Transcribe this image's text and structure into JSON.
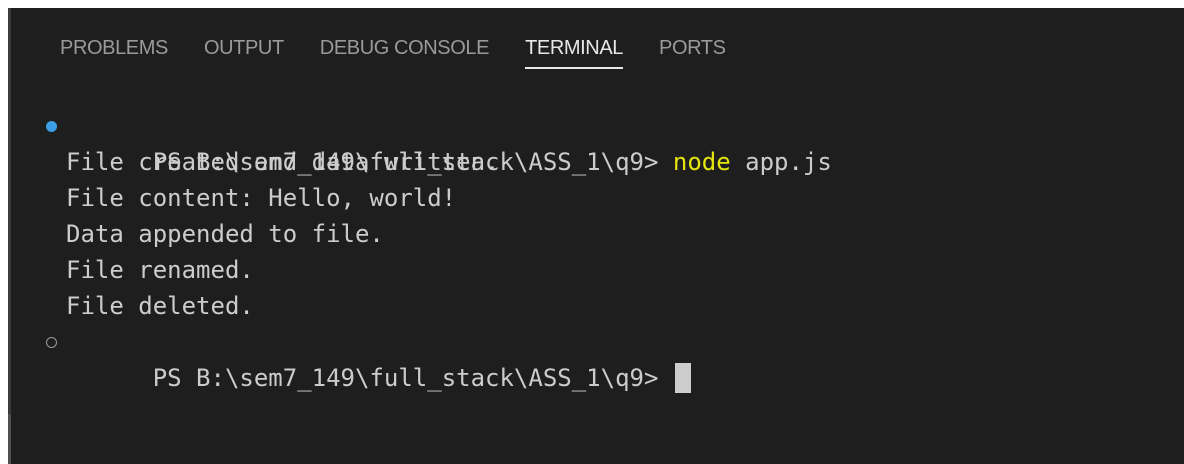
{
  "tabs": [
    {
      "label": "PROBLEMS",
      "active": false
    },
    {
      "label": "OUTPUT",
      "active": false
    },
    {
      "label": "DEBUG CONSOLE",
      "active": false
    },
    {
      "label": "TERMINAL",
      "active": true
    },
    {
      "label": "PORTS",
      "active": false
    }
  ],
  "terminal": {
    "prompt_1": "PS B:\\sem7_149\\full_stack\\ASS_1\\q9> ",
    "command_name": "node",
    "command_args": " app.js",
    "output": [
      "File created and data written.",
      "File content: Hello, world!",
      "Data appended to file.",
      "File renamed.",
      "File deleted."
    ],
    "prompt_2": "PS B:\\sem7_149\\full_stack\\ASS_1\\q9> "
  },
  "colors": {
    "background": "#1e1e1e",
    "text": "#cccccc",
    "command": "#e5e510",
    "status_dot_success": "#3c9ee6"
  },
  "icons": {
    "status_success": "filled-circle",
    "status_pending": "hollow-circle"
  }
}
